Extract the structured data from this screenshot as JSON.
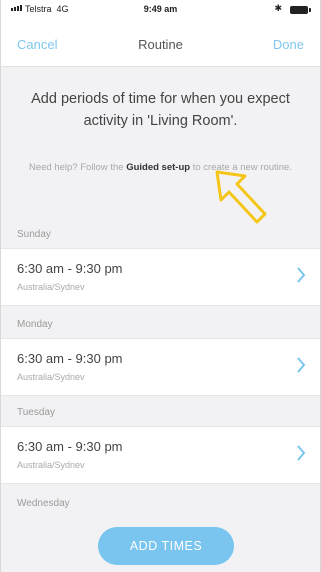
{
  "status_bar": {
    "carrier": "Telstra",
    "network": "4G",
    "time": "9:49 am",
    "bluetooth": "✱"
  },
  "nav": {
    "cancel": "Cancel",
    "title": "Routine",
    "done": "Done"
  },
  "intro": {
    "text": "Add periods of time for when you expect activity in 'Living Room'."
  },
  "help": {
    "prefix": "Need help? Follow the",
    "link": "Guided set-up",
    "suffix": "to create a new routine."
  },
  "days": [
    {
      "day": "Sunday",
      "range": "6:30 am - 9:30 pm",
      "timezone": "Australia/Sydnev"
    },
    {
      "day": "Monday",
      "range": "6:30 am - 9:30 pm",
      "timezone": "Australia/Sydnev"
    },
    {
      "day": "Tuesday",
      "range": "6:30 am - 9:30 pm",
      "timezone": "Australia/Sydnev"
    }
  ],
  "last_day": "Wednesday",
  "add_button": "ADD TIMES",
  "colors": {
    "accent": "#79c5ef",
    "annotation_arrow": "#f5c518"
  }
}
